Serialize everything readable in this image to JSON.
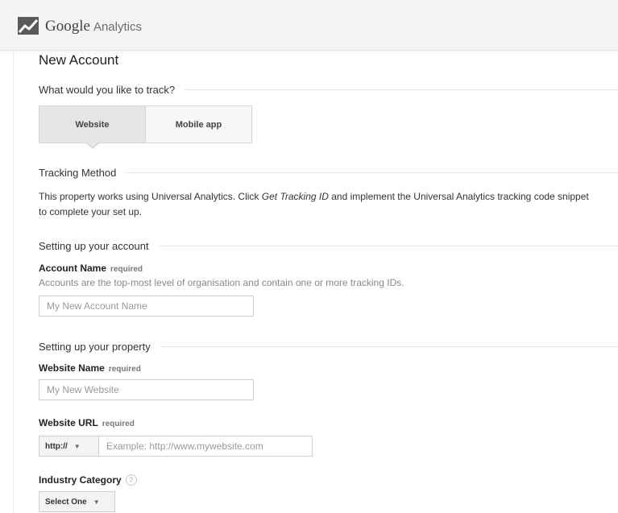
{
  "header": {
    "brand_google": "Google",
    "brand_analytics": "Analytics"
  },
  "page": {
    "title": "New Account"
  },
  "track": {
    "question": "What would you like to track?",
    "options": [
      "Website",
      "Mobile app"
    ],
    "selected": "Website"
  },
  "tracking_method": {
    "heading": "Tracking Method",
    "text_before": "This property works using Universal Analytics. Click ",
    "text_link": "Get Tracking ID",
    "text_after": " and implement the Universal Analytics tracking code snippet",
    "text_line2": "to complete your set up."
  },
  "account": {
    "heading": "Setting up your account",
    "name_label": "Account Name",
    "required": "required",
    "help": "Accounts are the top-most level of organisation and contain one or more tracking IDs.",
    "name_placeholder": "My New Account Name"
  },
  "property": {
    "heading": "Setting up your property",
    "website_name_label": "Website Name",
    "required": "required",
    "website_name_placeholder": "My New Website",
    "website_url_label": "Website URL",
    "protocol": "http://",
    "url_placeholder": "Example: http://www.mywebsite.com",
    "industry_label": "Industry Category",
    "industry_help_symbol": "?",
    "industry_select": "Select One"
  },
  "icons": {
    "logo": "analytics-logo-icon",
    "dropdown": "chevron-down-icon",
    "help": "help-circle-icon"
  }
}
